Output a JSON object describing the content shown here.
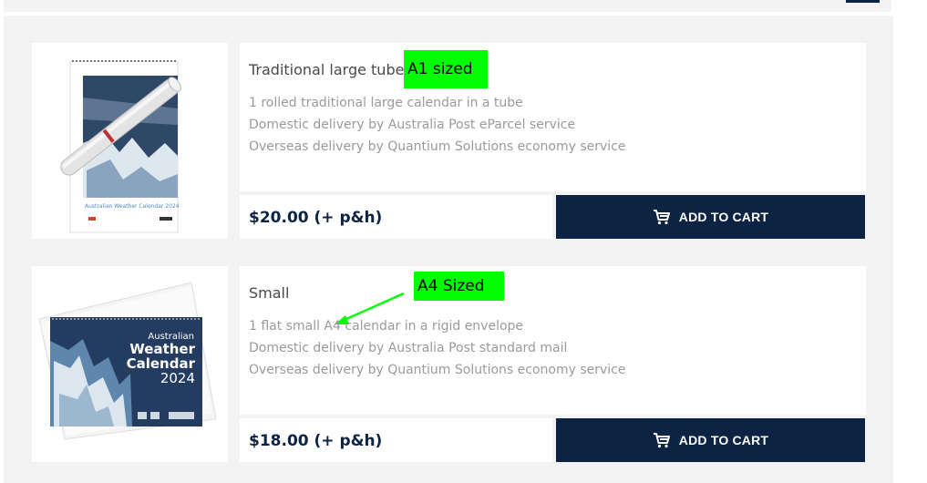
{
  "products": [
    {
      "title": "Traditional large tube",
      "tag": "A1 sized",
      "lines": [
        "1 rolled traditional large calendar in a tube",
        "Domestic delivery by Australia Post eParcel service",
        "Overseas delivery by Quantium Solutions economy service"
      ],
      "price": "$20.00 (+ p&h)",
      "cart_label": "ADD TO CART",
      "calendar_caption": "Australian Weather Calendar 2024"
    },
    {
      "title": "Small",
      "tag": "A4 Sized",
      "lines": [
        "1 flat small A4 calendar in a rigid envelope",
        "Domestic delivery by Australia Post standard mail",
        "Overseas delivery by Quantium Solutions economy service"
      ],
      "price": "$18.00 (+ p&h)",
      "cart_label": "ADD TO CART",
      "cover_lines": [
        "Australian",
        "Weather",
        "Calendar",
        "2024"
      ]
    }
  ],
  "colors": {
    "navy": "#0d2344",
    "highlight": "#00ff00",
    "panel": "#f3f3f3"
  }
}
